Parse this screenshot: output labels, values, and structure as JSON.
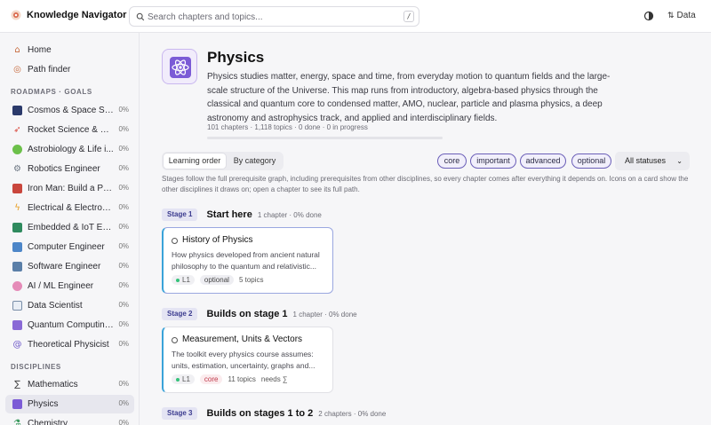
{
  "app": {
    "title": "Knowledge Navigator",
    "data_label": "Data"
  },
  "search": {
    "placeholder": "Search chapters and topics...",
    "shortcut": "/"
  },
  "sidebar": {
    "top": [
      {
        "label": "Home",
        "icon": "home-icon"
      },
      {
        "label": "Path finder",
        "icon": "path-icon"
      }
    ],
    "roadmaps_heading": "ROADMAPS · GOALS",
    "roadmaps": [
      {
        "label": "Cosmos & Space Sci...",
        "pct": "0%",
        "icon": "cosmos-icon"
      },
      {
        "label": "Rocket Science & Sp...",
        "pct": "0%",
        "icon": "rocket-icon"
      },
      {
        "label": "Astrobiology & Life i...",
        "pct": "0%",
        "icon": "alien-icon"
      },
      {
        "label": "Robotics Engineer",
        "pct": "0%",
        "icon": "robot-icon"
      },
      {
        "label": "Iron Man: Build a Po...",
        "pct": "0%",
        "icon": "ironman-icon"
      },
      {
        "label": "Electrical & Electroni...",
        "pct": "0%",
        "icon": "lightning-icon"
      },
      {
        "label": "Embedded & IoT Eng...",
        "pct": "0%",
        "icon": "chip-icon"
      },
      {
        "label": "Computer Engineer",
        "pct": "0%",
        "icon": "computer-icon"
      },
      {
        "label": "Software Engineer",
        "pct": "0%",
        "icon": "laptop-icon"
      },
      {
        "label": "AI / ML Engineer",
        "pct": "0%",
        "icon": "brain-icon"
      },
      {
        "label": "Data Scientist",
        "pct": "0%",
        "icon": "chart-icon"
      },
      {
        "label": "Quantum Computing...",
        "pct": "0%",
        "icon": "quantum-icon"
      },
      {
        "label": "Theoretical Physicist",
        "pct": "0%",
        "icon": "spiral-icon"
      }
    ],
    "disciplines_heading": "DISCIPLINES",
    "disciplines": [
      {
        "label": "Mathematics",
        "pct": "0%",
        "icon": "sigma-icon"
      },
      {
        "label": "Physics",
        "pct": "0%",
        "icon": "atom-icon",
        "active": true
      },
      {
        "label": "Chemistry",
        "pct": "0%",
        "icon": "flask-icon"
      }
    ]
  },
  "hero": {
    "title": "Physics",
    "description": "Physics studies matter, energy, space and time, from everyday motion to quantum fields and the large-scale structure of the Universe. This map runs from introductory, algebra-based physics through the classical and quantum core to condensed matter, AMO, nuclear, particle and plasma physics, a deep astronomy and astrophysics track, and applied and interdisciplinary fields.",
    "stats": "101 chapters · 1,118 topics · 0 done · 0 in progress",
    "progress": 0
  },
  "tabs": [
    "Learning order",
    "By category"
  ],
  "chips": [
    "core",
    "important",
    "advanced",
    "optional"
  ],
  "status_select": "All statuses",
  "hint": "Stages follow the full prerequisite graph, including prerequisites from other disciplines, so every chapter comes after everything it depends on. Icons on a card show the other disciplines it draws on; open a chapter to see its full path.",
  "stages": [
    {
      "badge": "Stage 1",
      "title": "Start here",
      "meta": "1 chapter · 0% done",
      "card": {
        "title": "History of Physics",
        "desc": "How physics developed from ancient natural philosophy to the quantum and relativistic...",
        "level": "L1",
        "tag": "optional",
        "topics": "5 topics",
        "needs": ""
      }
    },
    {
      "badge": "Stage 2",
      "title": "Builds on stage 1",
      "meta": "1 chapter · 0% done",
      "card": {
        "title": "Measurement, Units & Vectors",
        "desc": "The toolkit every physics course assumes: units, estimation, uncertainty, graphs and...",
        "level": "L1",
        "tag": "core",
        "topics": "11 topics",
        "needs": "needs ∑"
      }
    },
    {
      "badge": "Stage 3",
      "title": "Builds on stages 1 to 2",
      "meta": "2 chapters · 0% done"
    }
  ],
  "colors": {
    "accent": "#7b5bd6",
    "card_stripe": "#3aa3d9",
    "core": "#c0394b",
    "level_dot": "#35c27a"
  }
}
